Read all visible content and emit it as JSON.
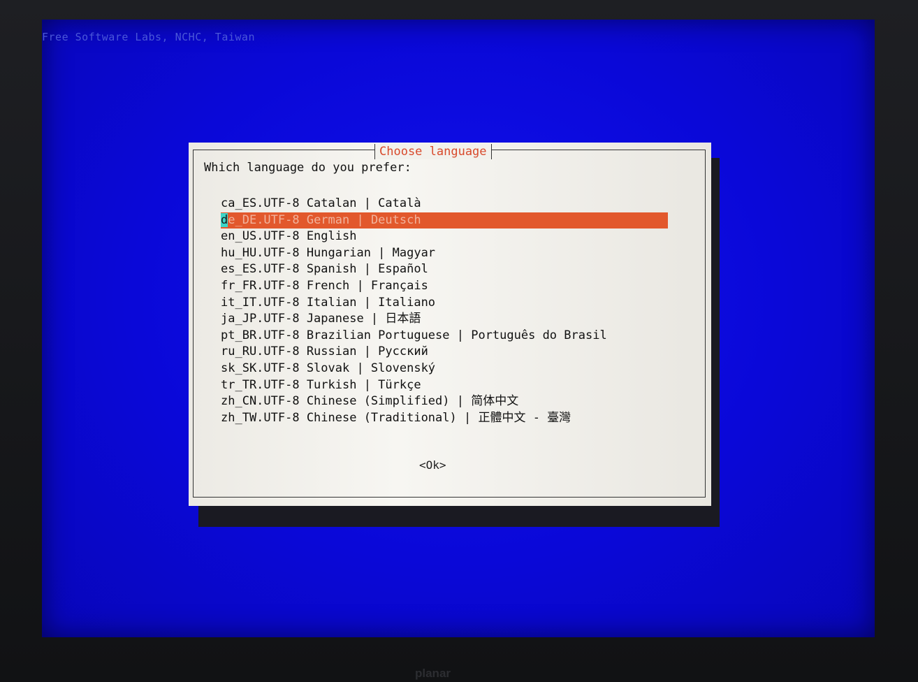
{
  "screen": {
    "banner": "Free Software Labs, NCHC, Taiwan"
  },
  "dialog": {
    "title": "Choose language",
    "prompt": "Which language do you prefer:",
    "selected_index": 1,
    "items": [
      {
        "label": "ca_ES.UTF-8 Catalan | Català"
      },
      {
        "label": "de_DE.UTF-8 German | Deutsch"
      },
      {
        "label": "en_US.UTF-8 English"
      },
      {
        "label": "hu_HU.UTF-8 Hungarian | Magyar"
      },
      {
        "label": "es_ES.UTF-8 Spanish | Español"
      },
      {
        "label": "fr_FR.UTF-8 French | Français"
      },
      {
        "label": "it_IT.UTF-8 Italian | Italiano"
      },
      {
        "label": "ja_JP.UTF-8 Japanese | 日本語"
      },
      {
        "label": "pt_BR.UTF-8 Brazilian Portuguese | Português do Brasil"
      },
      {
        "label": "ru_RU.UTF-8 Russian | Русский"
      },
      {
        "label": "sk_SK.UTF-8 Slovak | Slovenský"
      },
      {
        "label": "tr_TR.UTF-8 Turkish | Türkçe"
      },
      {
        "label": "zh_CN.UTF-8 Chinese (Simplified) | 简体中文"
      },
      {
        "label": "zh_TW.UTF-8 Chinese (Traditional) | 正體中文 - 臺灣"
      }
    ],
    "ok_label": "<Ok>"
  },
  "monitor": {
    "brand": "planar"
  },
  "colors": {
    "screen_bg": "#0a08d8",
    "dialog_bg": "#f2f1ec",
    "title_text": "#d84a2c",
    "selection_bg": "#e2582c",
    "cursor_bg": "#3cd6c8"
  }
}
